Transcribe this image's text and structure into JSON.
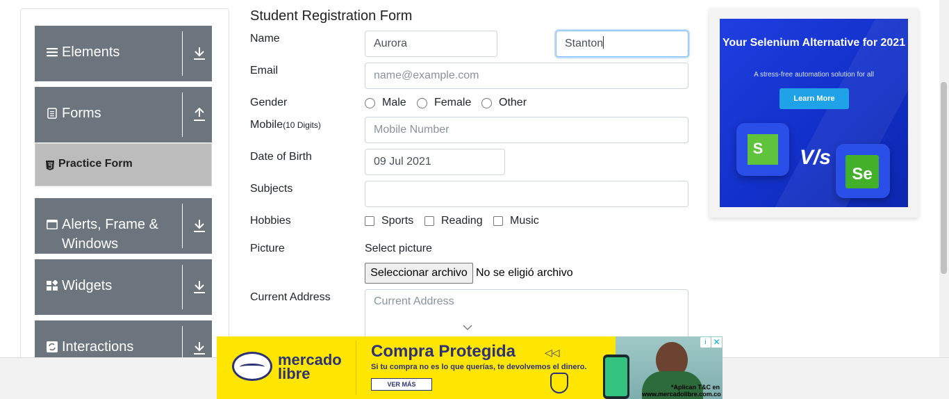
{
  "sidebar": {
    "groups": [
      {
        "label": "Elements",
        "icon": "hamburger-icon",
        "arrow": "download-arrow-icon"
      },
      {
        "label": "Forms",
        "icon": "document-icon",
        "arrow": "upload-arrow-icon"
      },
      {
        "label": "Alerts, Frame & Windows",
        "icon": "window-icon",
        "arrow": "download-arrow-icon"
      },
      {
        "label": "Widgets",
        "icon": "widgets-icon",
        "arrow": "download-arrow-icon"
      },
      {
        "label": "Interactions",
        "icon": "interactions-icon",
        "arrow": "download-arrow-icon"
      }
    ],
    "active_item": {
      "label": "Practice Form",
      "icon": "html5-icon"
    }
  },
  "form": {
    "title": "Student Registration Form",
    "name_label": "Name",
    "first_name": "Aurora",
    "last_name": "Stanton",
    "email_label": "Email",
    "email_placeholder": "name@example.com",
    "gender_label": "Gender",
    "gender_options": [
      "Male",
      "Female",
      "Other"
    ],
    "mobile_label": "Mobile",
    "mobile_hint": "(10 Digits)",
    "mobile_placeholder": "Mobile Number",
    "dob_label": "Date of Birth",
    "dob_value": "09 Jul 2021",
    "subjects_label": "Subjects",
    "subjects_value": "",
    "hobbies_label": "Hobbies",
    "hobbies_options": [
      "Sports",
      "Reading",
      "Music"
    ],
    "picture_label": "Picture",
    "select_picture": "Select picture",
    "file_button": "Seleccionar archivo",
    "file_status": "No se eligió archivo",
    "address_label": "Current Address",
    "address_placeholder": "Current Address"
  },
  "ad_right": {
    "title": "Your Selenium Alternative for 2021",
    "subtitle": "A stress-free automation solution for all",
    "button": "Learn More",
    "logo_left": "S",
    "vs": "V/s",
    "logo_right": "Se"
  },
  "ad_bottom": {
    "brand_line1": "mercado",
    "brand_line2": "libre",
    "title": "Compra Protegida",
    "arrows": "◁◁",
    "subtitle": "Si tu compra no es lo que querías, te devolvemos el dinero.",
    "button": "VER MÁS",
    "tc": "*Aplican T&C en www.mercadolibre.com.co",
    "adchoice": "i",
    "close": "✕"
  },
  "colors": {
    "sidebar_group_bg": "#6c757d",
    "active_item_bg": "#bcbcbc",
    "focus_border": "#80bdff",
    "ad_blue": "#1f3fe0",
    "ad_yellow": "#ffe600"
  }
}
